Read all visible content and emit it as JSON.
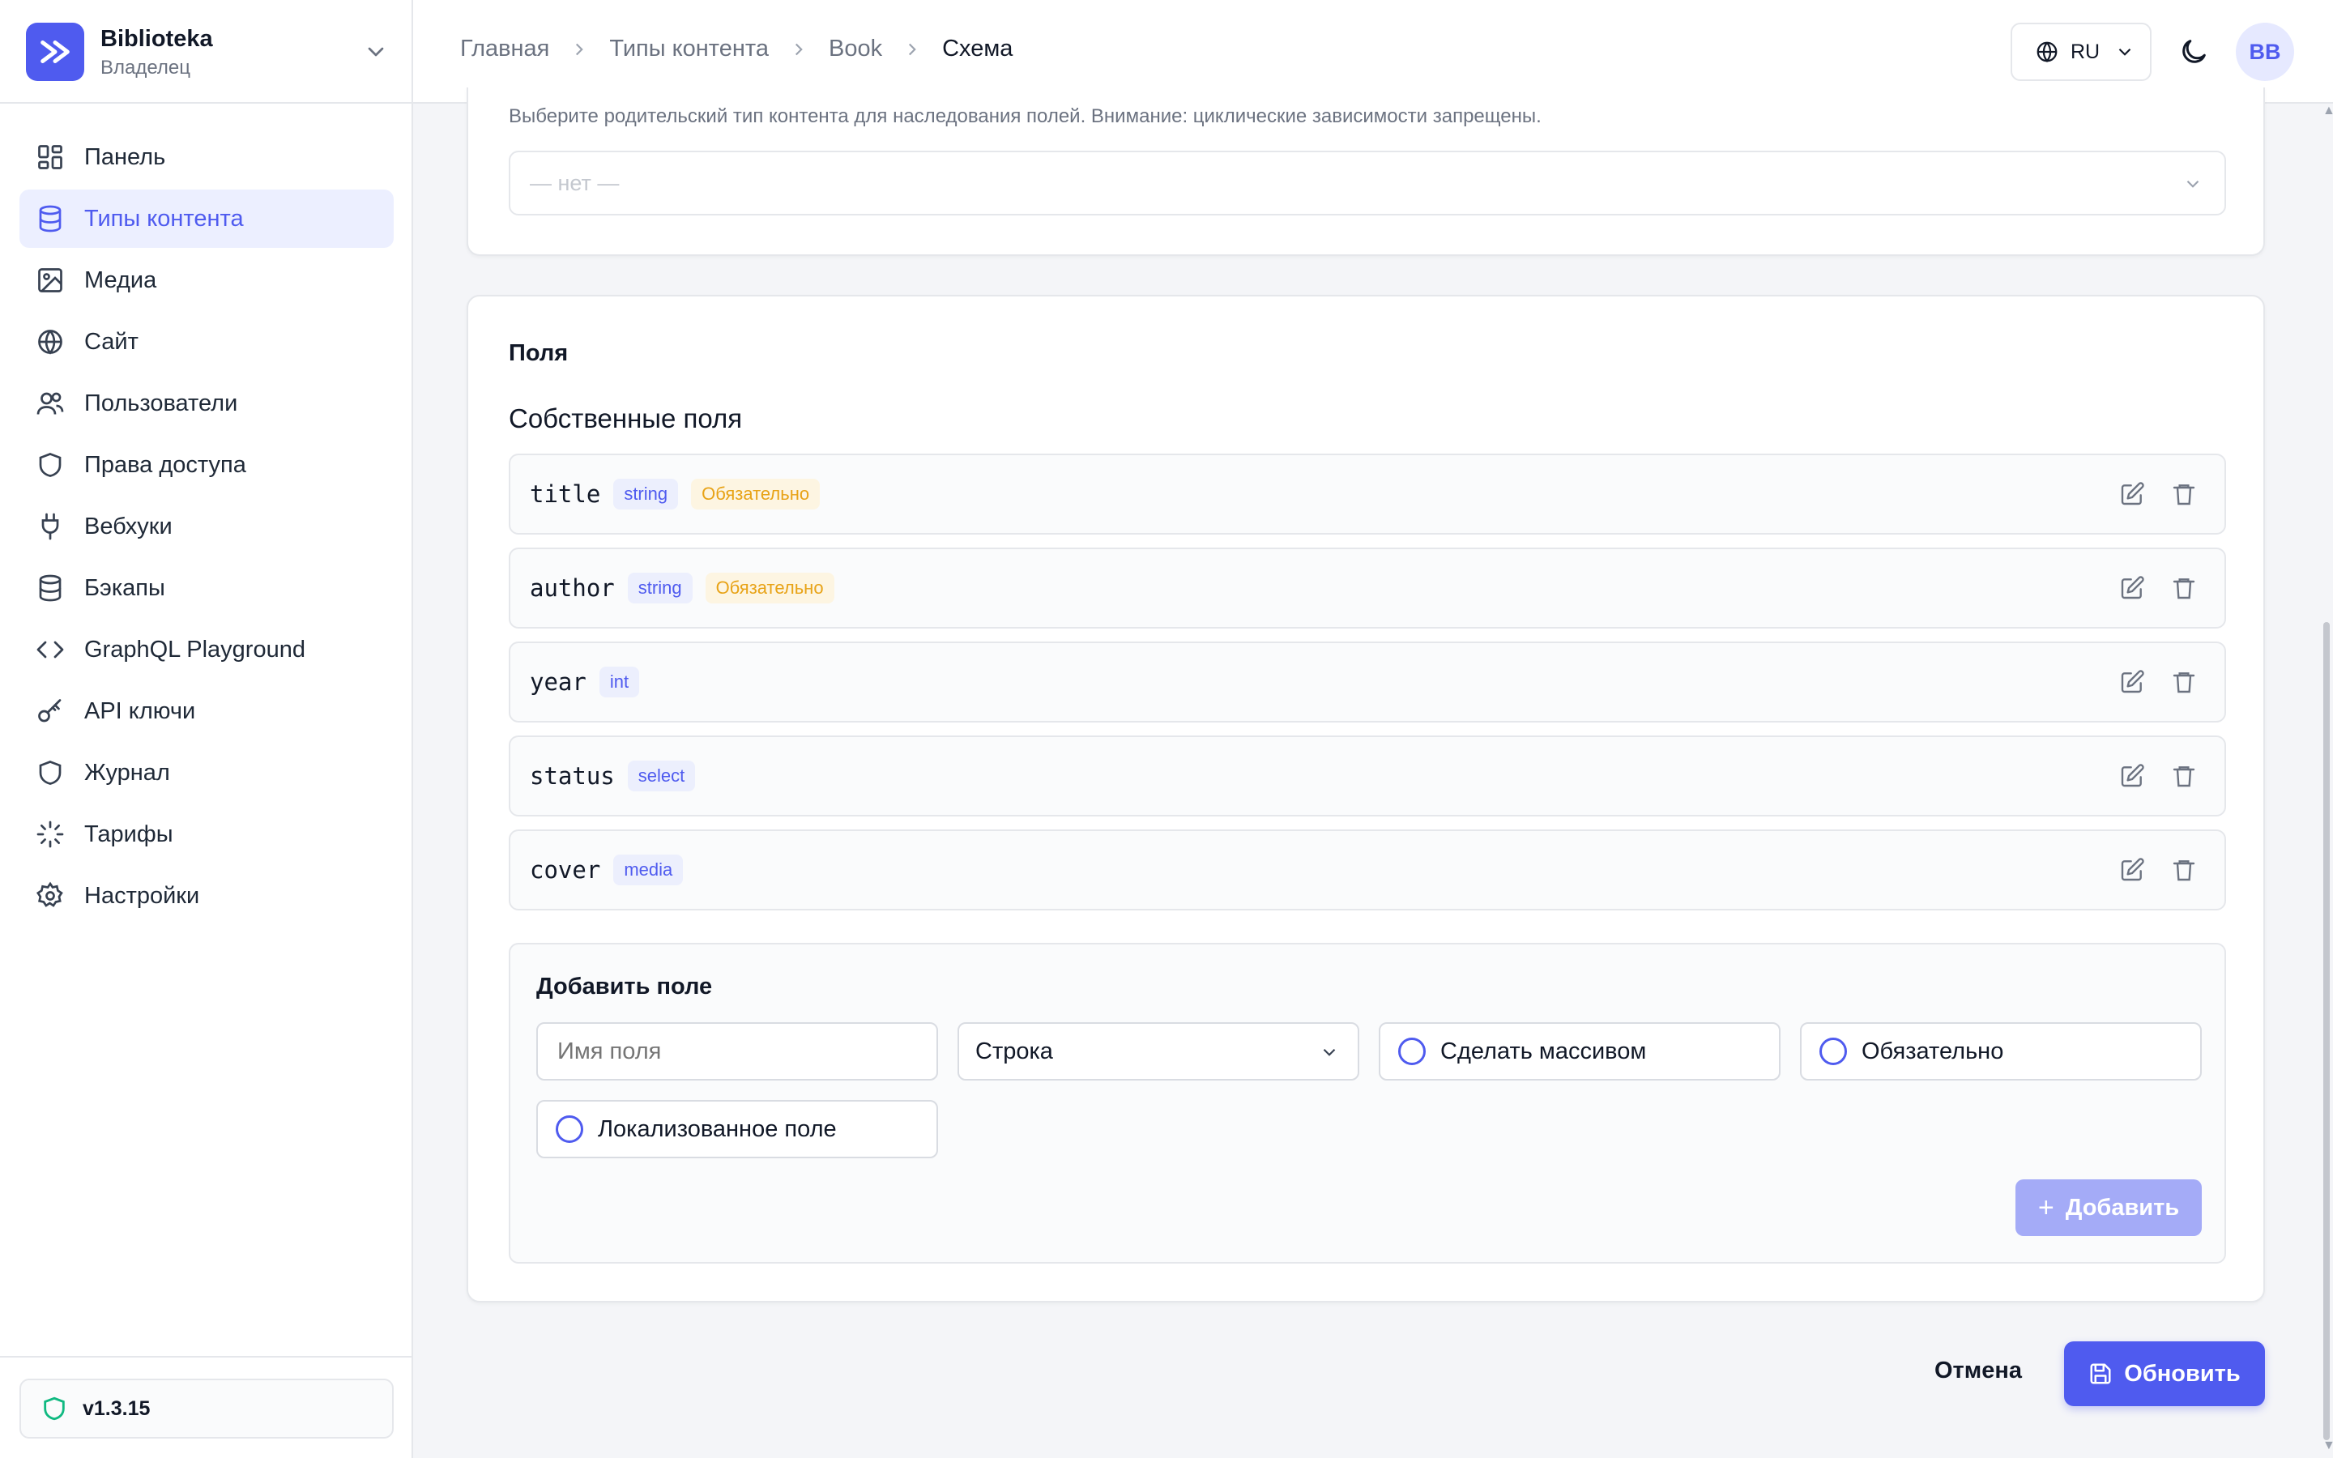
{
  "org": {
    "name": "Biblioteka",
    "role": "Владелец"
  },
  "sidebar": {
    "items": [
      {
        "label": "Панель",
        "icon": "dashboard-icon"
      },
      {
        "label": "Типы контента",
        "icon": "database-icon",
        "active": true
      },
      {
        "label": "Медиа",
        "icon": "image-icon"
      },
      {
        "label": "Сайт",
        "icon": "globe-icon"
      },
      {
        "label": "Пользователи",
        "icon": "users-icon"
      },
      {
        "label": "Права доступа",
        "icon": "shield-icon"
      },
      {
        "label": "Вебхуки",
        "icon": "plug-icon"
      },
      {
        "label": "Бэкапы",
        "icon": "database-icon"
      },
      {
        "label": "GraphQL Playground",
        "icon": "code-icon"
      },
      {
        "label": "API ключи",
        "icon": "key-icon"
      },
      {
        "label": "Журнал",
        "icon": "shield-icon"
      },
      {
        "label": "Тарифы",
        "icon": "loader-icon"
      },
      {
        "label": "Настройки",
        "icon": "gear-icon"
      }
    ],
    "version": "v1.3.15"
  },
  "breadcrumb": [
    "Главная",
    "Типы контента",
    "Book",
    "Схема"
  ],
  "topbar": {
    "lang": "RU",
    "avatar": "BB"
  },
  "parent": {
    "hint": "Выберите родительский тип контента для наследования полей. Внимание: циклические зависимости запрещены.",
    "selected": "— нет —"
  },
  "fields": {
    "title": "Поля",
    "own_title": "Собственные поля",
    "required_label": "Обязательно",
    "items": [
      {
        "name": "title",
        "type": "string",
        "required": "Обязательно"
      },
      {
        "name": "author",
        "type": "string",
        "required": "Обязательно"
      },
      {
        "name": "year",
        "type": "int"
      },
      {
        "name": "status",
        "type": "select"
      },
      {
        "name": "cover",
        "type": "media"
      }
    ]
  },
  "add_field": {
    "title": "Добавить поле",
    "name_placeholder": "Имя поля",
    "type_selected": "Строка",
    "array_label": "Сделать массивом",
    "required_label": "Обязательно",
    "localized_label": "Локализованное поле",
    "add_button": "Добавить"
  },
  "actions": {
    "cancel": "Отмена",
    "save": "Обновить"
  },
  "colors": {
    "accent": "#4f5bef",
    "accent_light": "#ecefff",
    "required": "#e8a317",
    "version_icon": "#10b981"
  }
}
